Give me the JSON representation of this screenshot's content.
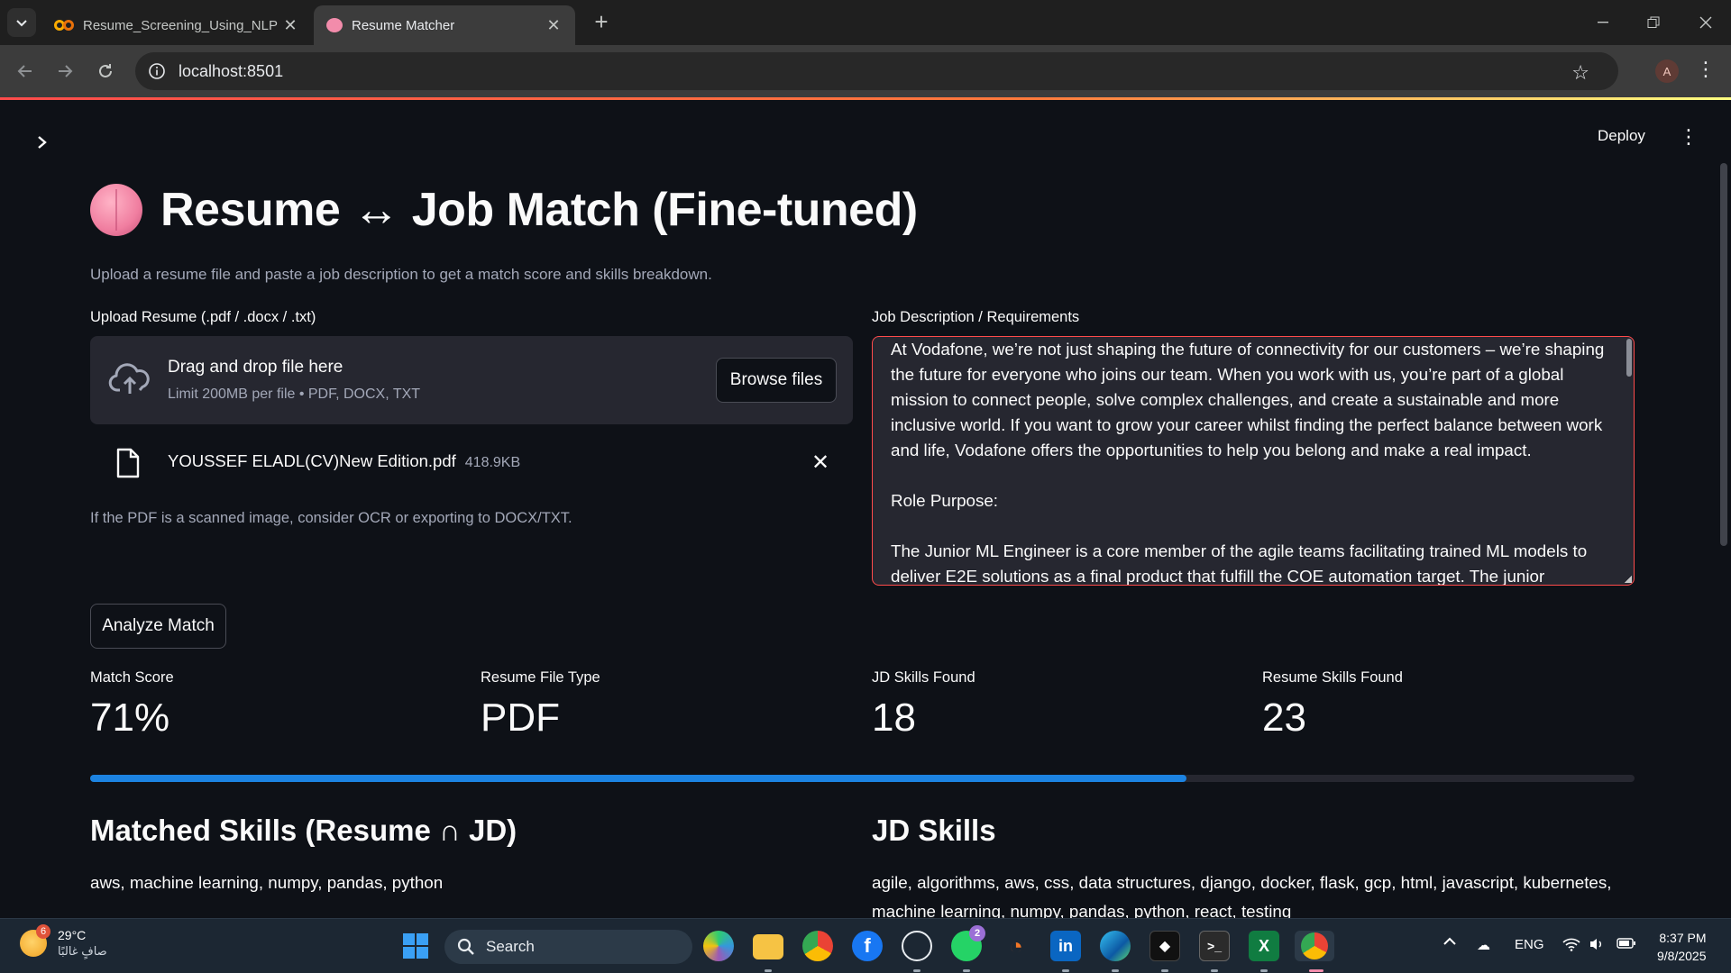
{
  "browser": {
    "tabs": [
      {
        "title": "Resume_Screening_Using_NLP (",
        "icon": "colab-icon",
        "active": false
      },
      {
        "title": "Resume Matcher",
        "icon": "brain-icon",
        "active": true
      }
    ],
    "url": "localhost:8501",
    "profile_initial": "A"
  },
  "app": {
    "deploy_label": "Deploy",
    "title": "Resume ↔ Job Match (Fine-tuned)",
    "subtitle": "Upload a resume file and paste a job description to get a match score and skills breakdown.",
    "upload": {
      "label": "Upload Resume (.pdf / .docx / .txt)",
      "drop_title": "Drag and drop file here",
      "drop_limit": "Limit 200MB per file • PDF, DOCX, TXT",
      "browse_label": "Browse files",
      "file_name": "YOUSSEF ELADL(CV)New Edition.pdf",
      "file_size": "418.9KB",
      "hint": "If the PDF is a scanned image, consider OCR or exporting to DOCX/TXT."
    },
    "jd": {
      "label": "Job Description / Requirements",
      "para1": "At Vodafone, we’re not just shaping the future of connectivity for our customers – we’re shaping the future for everyone who joins our team. When you work with us, you’re part of a global mission to connect people, solve complex challenges, and create a sustainable and more inclusive world. If you want to grow your career whilst finding the perfect balance between work and life, Vodafone offers the opportunities to help you belong and make a real impact.",
      "para2": "Role Purpose:",
      "para3": "The Junior ML Engineer is a core member of the agile teams facilitating trained ML models to deliver E2E solutions as a final product that fulfill the COE automation target. The junior"
    },
    "analyze_label": "Analyze Match",
    "metrics": {
      "match_score": {
        "label": "Match Score",
        "value": "71%"
      },
      "file_type": {
        "label": "Resume File Type",
        "value": "PDF"
      },
      "jd_skills": {
        "label": "JD Skills Found",
        "value": "18"
      },
      "resume_skills": {
        "label": "Resume Skills Found",
        "value": "23"
      }
    },
    "progress_fraction": 0.71,
    "matched": {
      "heading": "Matched Skills (Resume ∩ JD)",
      "list": "aws, machine learning, numpy, pandas, python"
    },
    "jd_skills": {
      "heading": "JD Skills",
      "list": "agile, algorithms, aws, css, data structures, django, docker, flask, gcp, html, javascript, kubernetes, machine learning, numpy, pandas, python, react, testing"
    }
  },
  "taskbar": {
    "weather_temp": "29°C",
    "weather_desc": "صافٍ غالبًا",
    "weather_badge": "6",
    "search_label": "Search",
    "whatsapp_badge": "2",
    "language": "ENG",
    "time": "8:37 PM",
    "date": "9/8/2025"
  },
  "colors": {
    "accent_red": "#ff4b4b",
    "progress_blue": "#1c83e1",
    "app_bg": "#0e1117",
    "panel_bg": "#262730"
  }
}
